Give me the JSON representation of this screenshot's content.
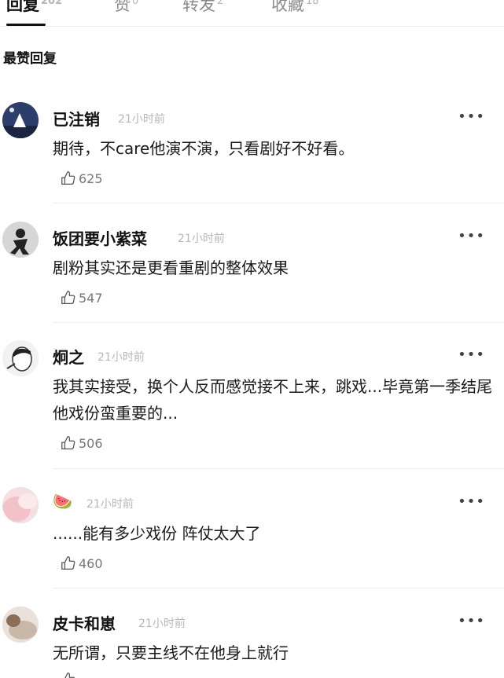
{
  "tabs": [
    {
      "label": "回复",
      "count": "202"
    },
    {
      "label": "赞",
      "count": "0"
    },
    {
      "label": "转发",
      "count": "2"
    },
    {
      "label": "收藏",
      "count": "18"
    }
  ],
  "section_title": "最赞回复",
  "more_glyph": "•••",
  "comments": [
    {
      "username": "已注销",
      "time": "21小时前",
      "text": "期待，不care他演不演，只看剧好不好看。",
      "likes": "625"
    },
    {
      "username": "饭团要小紫菜",
      "time": "21小时前",
      "text": "剧粉其实还是更看重剧的整体效果",
      "likes": "547"
    },
    {
      "username": "炯之",
      "time": "21小时前",
      "text": "我其实接受，换个人反而感觉接不上来，跳戏...毕竟第一季结尾他戏份蛮重要的...",
      "likes": "506"
    },
    {
      "username": "🍉",
      "time": "21小时前",
      "text": "......能有多少戏份 阵仗太大了",
      "likes": "460"
    },
    {
      "username": "皮卡和崽",
      "time": "21小时前",
      "text": "无所谓，只要主线不在他身上就行",
      "likes": ""
    }
  ],
  "colors": {
    "text": "#111111",
    "muted": "#b7b7b7",
    "divider": "#eeeeee"
  }
}
